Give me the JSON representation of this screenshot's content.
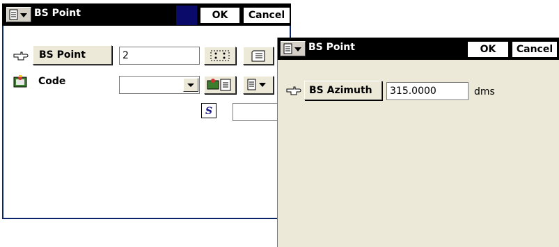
{
  "main_window": {
    "title": "BS Point",
    "ok_label": "OK",
    "cancel_label": "Cancel",
    "bs_point_button": "BS Point",
    "bs_point_value": "2",
    "code_label": "Code",
    "code_value": ""
  },
  "dialog": {
    "title": "BS Point",
    "ok_label": "OK",
    "cancel_label": "Cancel",
    "bs_azimuth_button": "BS Azimuth",
    "bs_azimuth_value": "315.0000",
    "unit": "dms"
  },
  "icons": [
    "menu-icon",
    "pointing-hand-icon",
    "code-library-icon",
    "map-select-icon",
    "list-icon",
    "dropdown-arrow-icon",
    "italic-s-icon"
  ]
}
